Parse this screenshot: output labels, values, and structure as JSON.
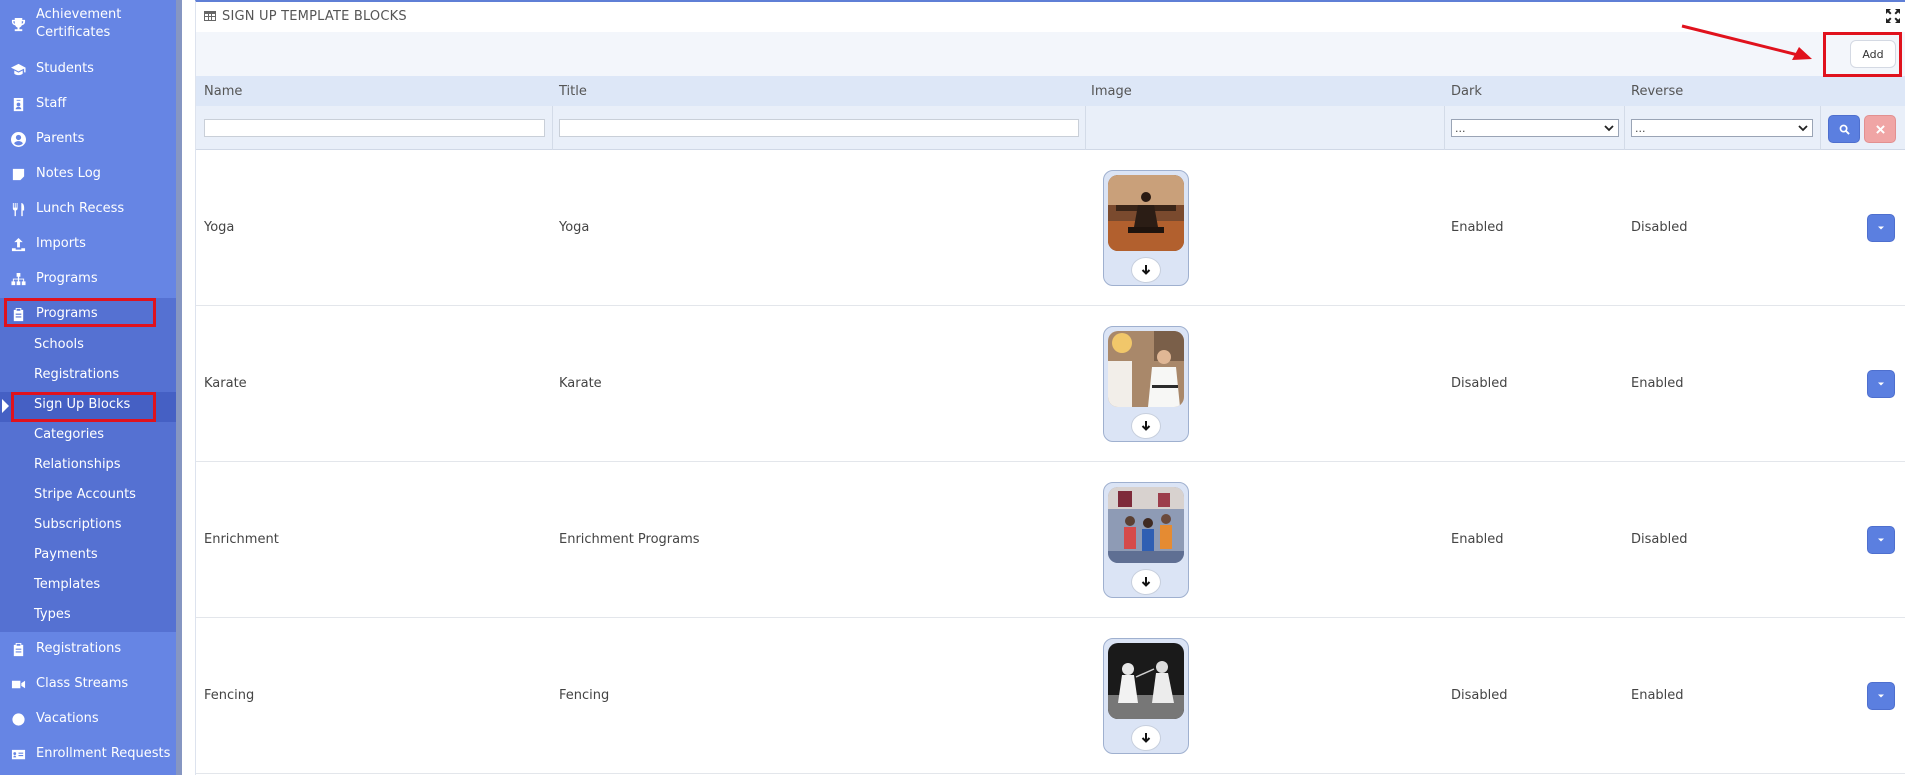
{
  "sidebar": {
    "items": [
      {
        "label": "Achievement Certificates",
        "icon": "trophy-icon"
      },
      {
        "label": "Students",
        "icon": "graduation-cap-icon"
      },
      {
        "label": "Staff",
        "icon": "id-badge-icon"
      },
      {
        "label": "Parents",
        "icon": "user-circle-icon"
      },
      {
        "label": "Notes Log",
        "icon": "note-icon"
      },
      {
        "label": "Lunch Recess",
        "icon": "utensils-icon"
      },
      {
        "label": "Imports",
        "icon": "upload-icon"
      },
      {
        "label": "Programs",
        "icon": "sitemap-icon"
      },
      {
        "label": "Programs",
        "icon": "clipboard-icon"
      }
    ],
    "sub_items": [
      "Schools",
      "Registrations",
      "Sign Up Blocks",
      "Categories",
      "Relationships",
      "Stripe Accounts",
      "Subscriptions",
      "Payments",
      "Templates",
      "Types"
    ],
    "active_sub_item": "Sign Up Blocks",
    "bottom_items": [
      {
        "label": "Registrations",
        "icon": "clipboard-icon"
      },
      {
        "label": "Class Streams",
        "icon": "video-icon"
      },
      {
        "label": "Vacations",
        "icon": "circle-icon"
      },
      {
        "label": "Enrollment Requests",
        "icon": "address-card-icon"
      }
    ]
  },
  "panel": {
    "title": "SIGN UP TEMPLATE BLOCKS",
    "add_label": "Add"
  },
  "table": {
    "columns": [
      "Name",
      "Title",
      "Image",
      "Dark",
      "Reverse"
    ],
    "filters": {
      "dark_selected": "...",
      "reverse_selected": "..."
    },
    "rows": [
      {
        "name": "Yoga",
        "title": "Yoga",
        "dark": "Enabled",
        "reverse": "Disabled"
      },
      {
        "name": "Karate",
        "title": "Karate",
        "dark": "Disabled",
        "reverse": "Enabled"
      },
      {
        "name": "Enrichment",
        "title": "Enrichment Programs",
        "dark": "Enabled",
        "reverse": "Disabled"
      },
      {
        "name": "Fencing",
        "title": "Fencing",
        "dark": "Disabled",
        "reverse": "Enabled"
      }
    ]
  },
  "colors": {
    "sidebar_bg": "#6685e4",
    "accent": "#5b7fe0",
    "highlight": "#e0121d"
  }
}
